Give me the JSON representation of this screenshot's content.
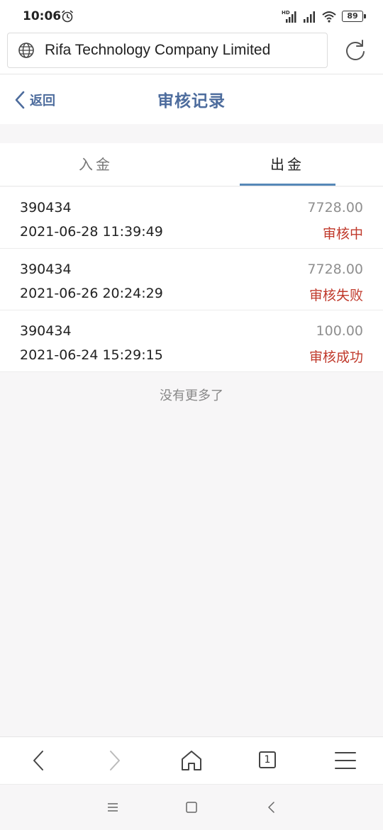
{
  "status_bar": {
    "time": "10:06",
    "battery": "89",
    "network": "HD"
  },
  "browser": {
    "url_title": "Rifa Technology Company Limited"
  },
  "header": {
    "back_label": "返回",
    "title": "审核记录"
  },
  "tabs": [
    {
      "label": "入金",
      "active": false
    },
    {
      "label": "出金",
      "active": true
    }
  ],
  "records": [
    {
      "id": "390434",
      "amount": "7728.00",
      "time": "2021-06-28 11:39:49",
      "status": "审核中"
    },
    {
      "id": "390434",
      "amount": "7728.00",
      "time": "2021-06-26 20:24:29",
      "status": "审核失败"
    },
    {
      "id": "390434",
      "amount": "100.00",
      "time": "2021-06-24 15:29:15",
      "status": "审核成功"
    }
  ],
  "footer_text": "没有更多了",
  "browser_nav": {
    "tab_count": "1"
  },
  "colors": {
    "accent": "#4d6c9d",
    "tab_underline": "#5688b8",
    "status_red": "#c0392b"
  }
}
